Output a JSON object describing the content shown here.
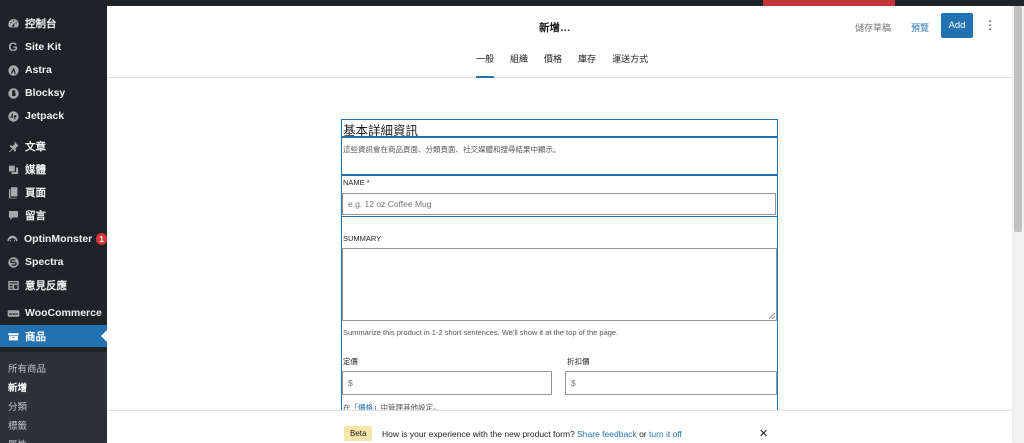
{
  "sidebar": {
    "items": [
      {
        "label": "控制台",
        "icon": "dashboard-icon"
      },
      {
        "label": "Site Kit",
        "icon": "google-g-icon"
      },
      {
        "label": "Astra",
        "icon": "astra-icon"
      },
      {
        "label": "Blocksy",
        "icon": "blocksy-icon"
      },
      {
        "label": "Jetpack",
        "icon": "jetpack-icon"
      },
      {
        "label": "文章",
        "icon": "pin-icon"
      },
      {
        "label": "媒體",
        "icon": "media-icon"
      },
      {
        "label": "頁面",
        "icon": "page-icon"
      },
      {
        "label": "留言",
        "icon": "comment-icon"
      },
      {
        "label": "OptinMonster",
        "icon": "optinmonster-icon",
        "badge": "1"
      },
      {
        "label": "Spectra",
        "icon": "spectra-icon"
      },
      {
        "label": "意見反應",
        "icon": "feedback-icon"
      },
      {
        "label": "WooCommerce",
        "icon": "woo-icon"
      },
      {
        "label": "商品",
        "icon": "products-icon"
      }
    ],
    "submenu": [
      "所有商品",
      "新增",
      "分類",
      "標籤",
      "屬性"
    ]
  },
  "header": {
    "title": "新增…",
    "save_draft": "儲存草稿",
    "preview": "預覽",
    "add": "Add",
    "more": "⋮",
    "tabs": [
      "一般",
      "組織",
      "價格",
      "庫存",
      "運送方式"
    ]
  },
  "form": {
    "section_title": "基本詳細資訊",
    "section_desc": "這些資訊會在商品頁面、分類頁面、社交媒體和搜尋結果中顯示。",
    "name_label": "NAME *",
    "name_placeholder": "e.g. 12 oz Coffee Mug",
    "summary_label": "SUMMARY",
    "summary_help": "Summarize this product in 1-2 short sentences. We'll show it at the top of the page.",
    "regular_price_label": "定價",
    "sale_price_label": "折扣價",
    "currency": "$",
    "price_help_pre": "在「",
    "price_help_link": "價格",
    "price_help_post": "」中管理其他設定。"
  },
  "notice": {
    "beta": "Beta",
    "text": "How is your experience with the new product form?",
    "share": "Share feedback",
    "or": "or",
    "turn_off": "turn it off",
    "close": "✕"
  },
  "colors": {
    "accent": "#2271b1",
    "sidebar": "#1d2327",
    "badge": "#d63638"
  }
}
